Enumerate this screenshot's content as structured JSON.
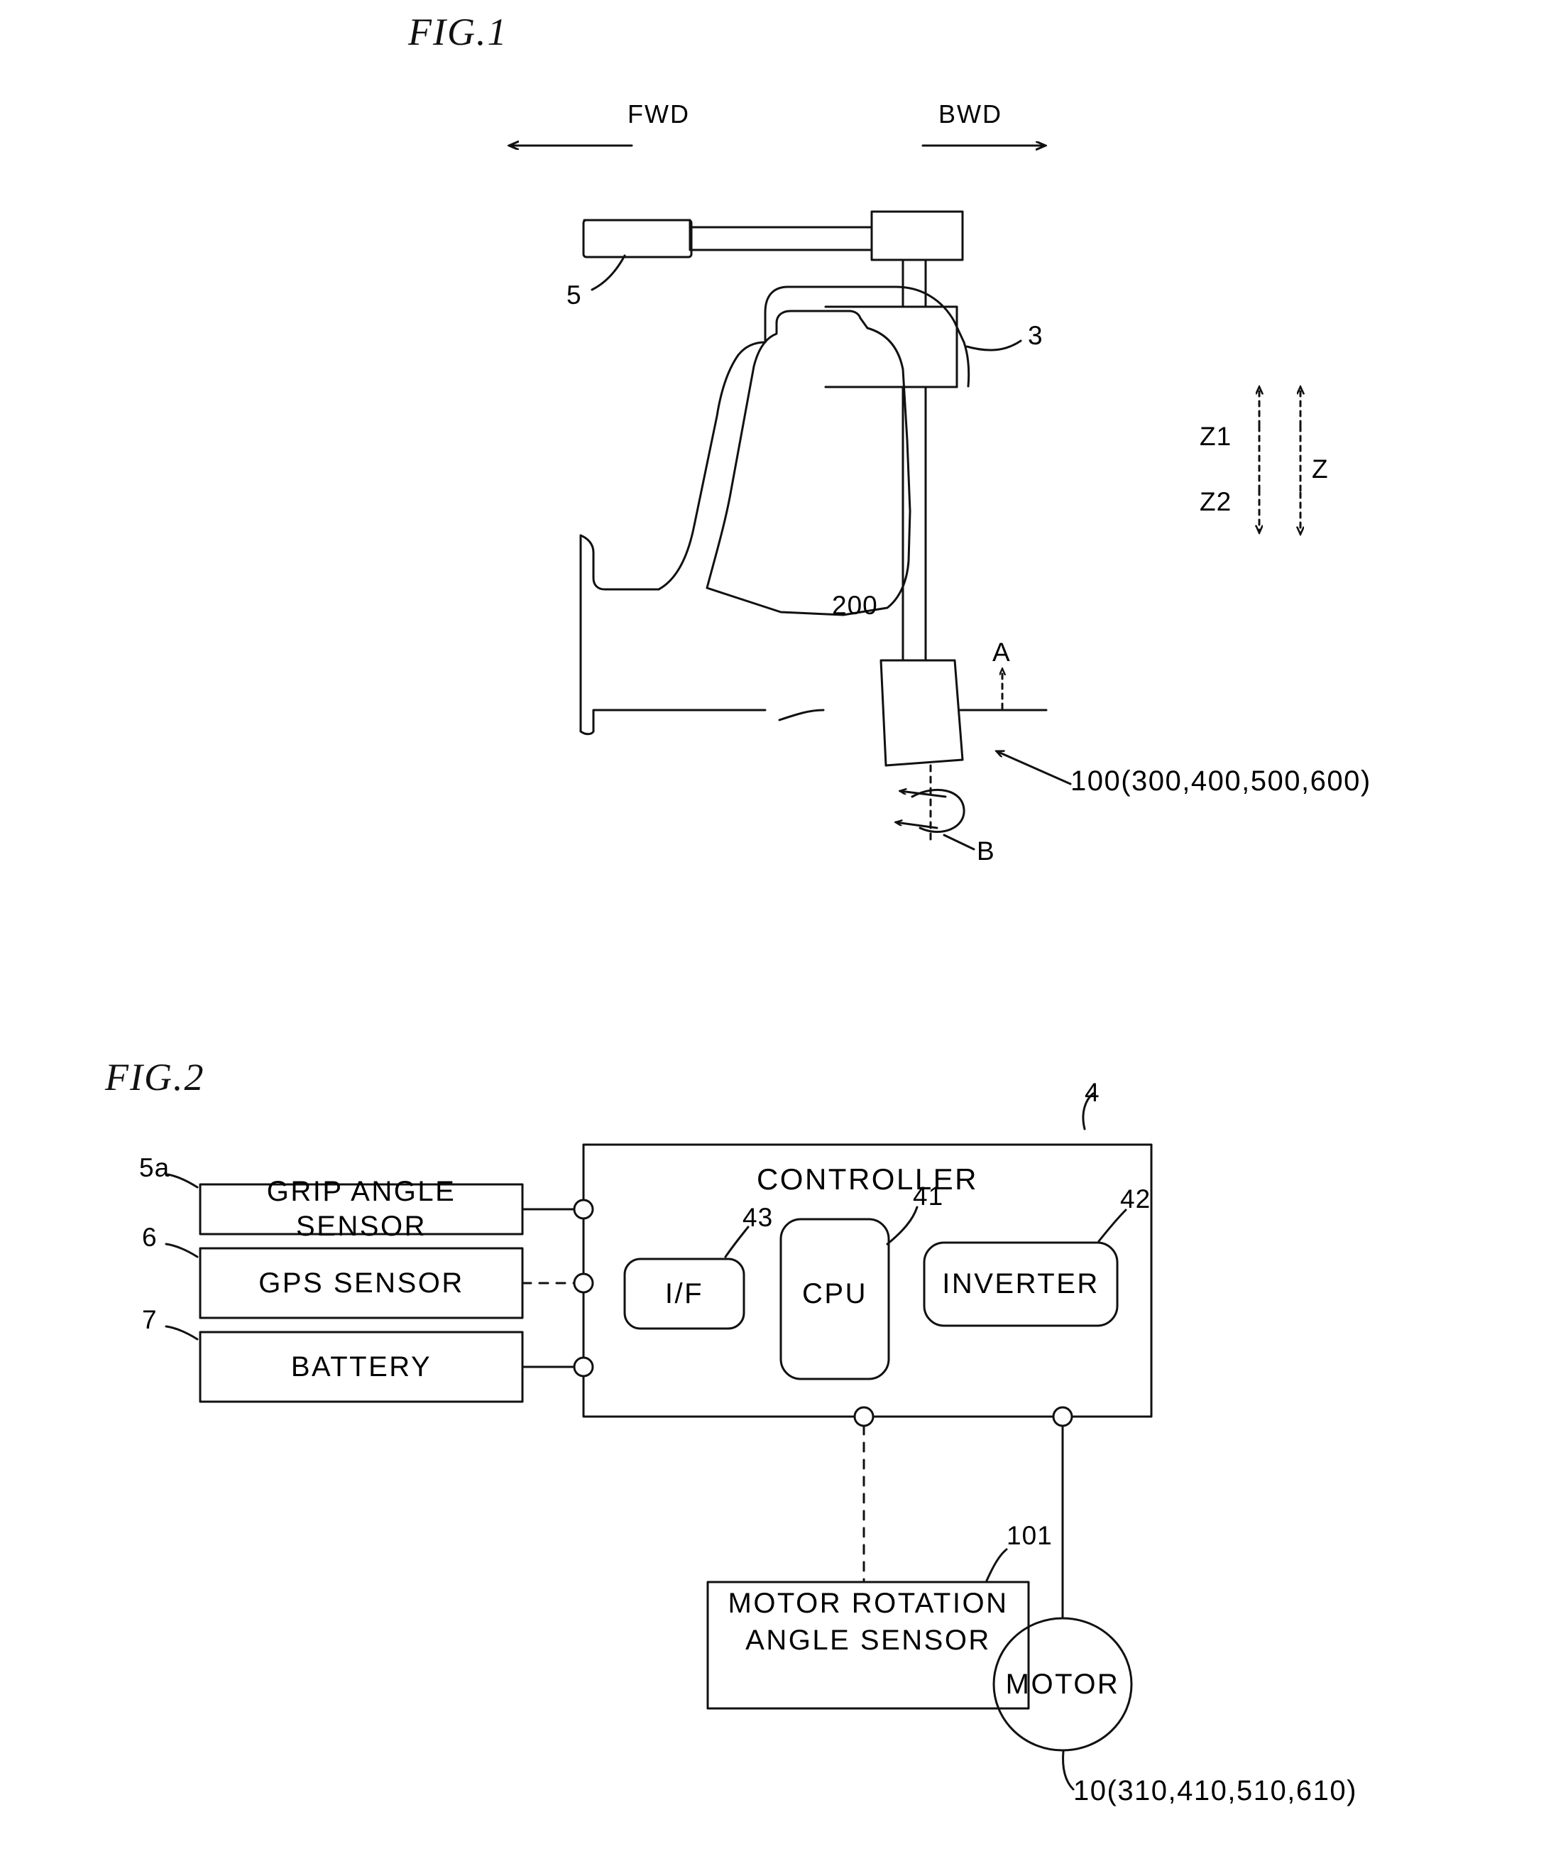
{
  "document": {
    "type": "patent-drawing-sheet",
    "figures": [
      "FIG.1",
      "FIG.2"
    ]
  },
  "fig1": {
    "title": "FIG.1",
    "direction_labels": {
      "forward": "FWD",
      "backward": "BWD"
    },
    "axis_labels": {
      "up": "Z1",
      "down": "Z2",
      "axis": "Z"
    },
    "motion_labels": {
      "tilt": "A",
      "rotation": "B"
    },
    "reference_numerals": {
      "grip": "5",
      "steering_shaft": "3",
      "vehicle_body": "200",
      "wheel_unit": "100(300,400,500,600)"
    }
  },
  "fig2": {
    "title": "FIG.2",
    "controller": {
      "label": "CONTROLLER",
      "ref": "4",
      "blocks": [
        {
          "label": "I/F",
          "ref": "43"
        },
        {
          "label": "CPU",
          "ref": "41"
        },
        {
          "label": "INVERTER",
          "ref": "42"
        }
      ]
    },
    "inputs": [
      {
        "label": "GRIP ANGLE SENSOR",
        "ref": "5a",
        "line_style": "solid"
      },
      {
        "label": "GPS SENSOR",
        "ref": "6",
        "line_style": "dashed"
      },
      {
        "label": "BATTERY",
        "ref": "7",
        "line_style": "solid"
      }
    ],
    "outputs": [
      {
        "label": "MOTOR ROTATION\nANGLE SENSOR",
        "line1": "MOTOR ROTATION",
        "line2": "ANGLE SENSOR",
        "ref": "101"
      },
      {
        "label": "MOTOR",
        "ref": "10(310,410,510,610)"
      }
    ]
  },
  "style": {
    "ink": "#111111",
    "background": "#ffffff",
    "stroke_width": 3
  }
}
